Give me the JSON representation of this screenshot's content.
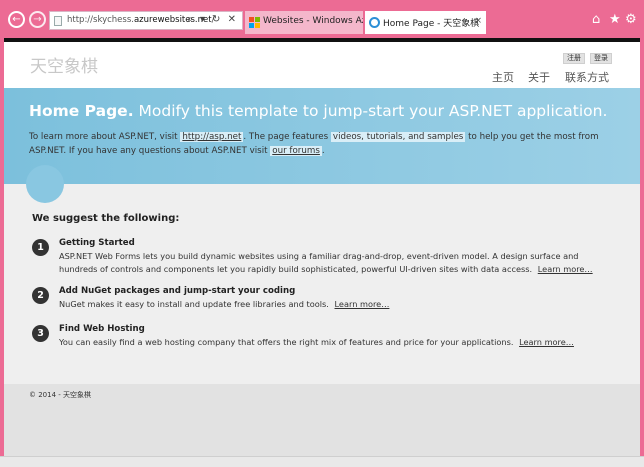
{
  "browser": {
    "url_prefix": "http://skychess.",
    "url_domain": "azurewebsites.net",
    "url_suffix": "/",
    "addr_tools": "⌕ ▾ ↻ ✕",
    "tabs": [
      {
        "label": "Websites - Windows Azure",
        "active": false
      },
      {
        "label": "Home Page - 天空象棋",
        "active": true
      }
    ],
    "tab_close": "×",
    "back_glyph": "←",
    "forward_glyph": "→",
    "home_glyph": "⌂",
    "favorites_glyph": "★",
    "tools_glyph": "⚙",
    "accent_color": "#ec6b94"
  },
  "header": {
    "site_title": "天空象棋",
    "register_label": "注册",
    "login_label": "登录",
    "nav": [
      "主页",
      "关于",
      "联系方式"
    ]
  },
  "featured": {
    "title_strong": "Home Page.",
    "title_rest": "Modify this template to jump-start your ASP.NET application.",
    "lead_1": "To learn more about ASP.NET, visit",
    "lead_link_1": "http://asp.net",
    "lead_2": ". The page features",
    "lead_highlight": "videos, tutorials, and samples",
    "lead_3": "to help you get the most from ASP.NET. If you have any questions about ASP.NET visit",
    "lead_link_2": "our forums",
    "lead_4": ".",
    "band_color": "#7cc0dc"
  },
  "content": {
    "suggest_title": "We suggest the following:",
    "steps": [
      {
        "num": "1",
        "title": "Getting Started",
        "desc": "ASP.NET Web Forms lets you build dynamic websites using a familiar drag-and-drop, event-driven model. A design surface and hundreds of controls and components let you rapidly build sophisticated, powerful UI-driven sites with data access.",
        "link": "Learn more…"
      },
      {
        "num": "2",
        "title": "Add NuGet packages and jump-start your coding",
        "desc": "NuGet makes it easy to install and update free libraries and tools.",
        "link": "Learn more…"
      },
      {
        "num": "3",
        "title": "Find Web Hosting",
        "desc": "You can easily find a web hosting company that offers the right mix of features and price for your applications.",
        "link": "Learn more…"
      }
    ]
  },
  "footer": {
    "text": "© 2014 - 天空象棋"
  }
}
